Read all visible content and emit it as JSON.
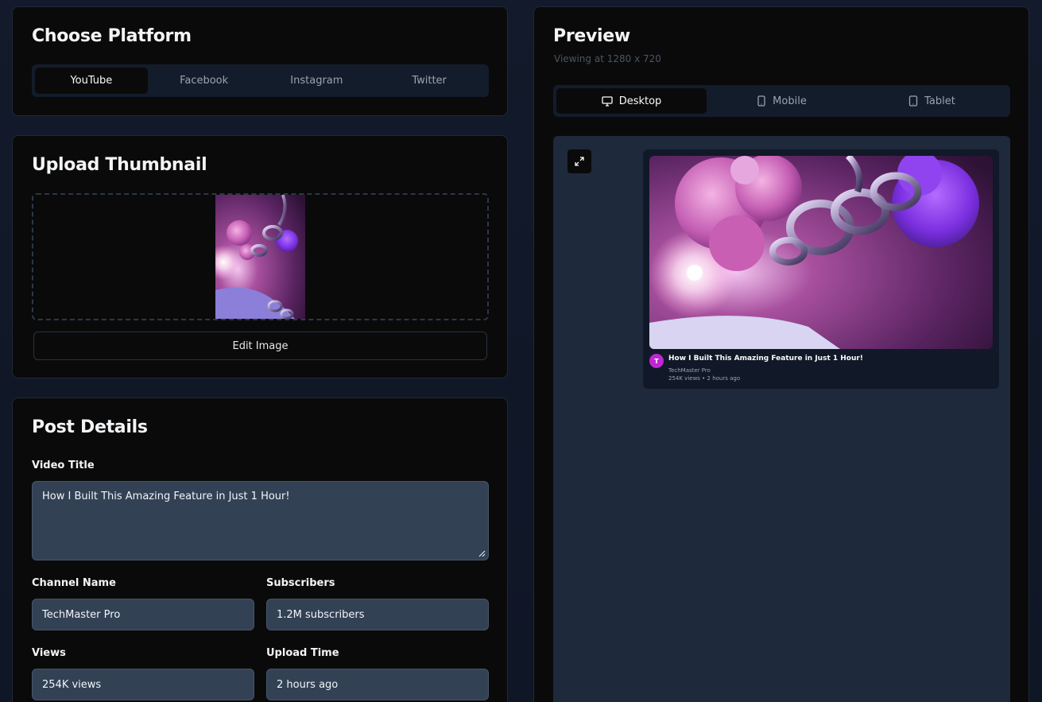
{
  "platform": {
    "title": "Choose Platform",
    "options": [
      "YouTube",
      "Facebook",
      "Instagram",
      "Twitter"
    ],
    "selected": "YouTube"
  },
  "upload": {
    "title": "Upload Thumbnail",
    "edit_label": "Edit Image"
  },
  "details": {
    "title": "Post Details",
    "video_title_label": "Video Title",
    "video_title_value": "How I Built This Amazing Feature in Just 1 Hour!",
    "channel_label": "Channel Name",
    "channel_value": "TechMaster Pro",
    "subscribers_label": "Subscribers",
    "subscribers_value": "1.2M subscribers",
    "views_label": "Views",
    "views_value": "254K views",
    "upload_time_label": "Upload Time",
    "upload_time_value": "2 hours ago"
  },
  "preview": {
    "title": "Preview",
    "viewing": "Viewing at 1280 x 720",
    "devices": [
      "Desktop",
      "Mobile",
      "Tablet"
    ],
    "selected_device": "Desktop",
    "card": {
      "avatar_letter": "T",
      "title": "How I Built This Amazing Feature in Just 1 Hour!",
      "channel": "TechMaster Pro",
      "meta": "254K views • 2 hours ago"
    }
  },
  "colors": {
    "background": "#111827",
    "card": "#0a0a0a",
    "input": "#334155",
    "preview_area": "#1e293b",
    "avatar": "#c026d3"
  }
}
